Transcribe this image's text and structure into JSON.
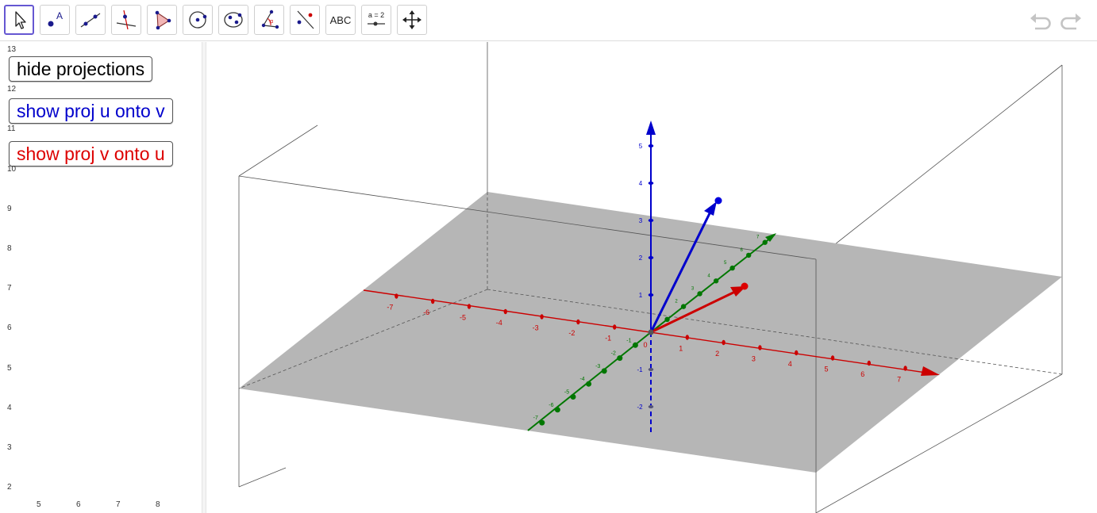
{
  "toolbar": {
    "tools": [
      {
        "name": "move-tool-icon",
        "selected": true
      },
      {
        "name": "point-tool-icon"
      },
      {
        "name": "line-tool-icon"
      },
      {
        "name": "perpendicular-line-tool-icon"
      },
      {
        "name": "polygon-tool-icon"
      },
      {
        "name": "circle-tool-icon"
      },
      {
        "name": "ellipse-tool-icon"
      },
      {
        "name": "angle-tool-icon"
      },
      {
        "name": "reflect-tool-icon"
      },
      {
        "name": "text-tool-icon",
        "label": "ABC"
      },
      {
        "name": "slider-tool-icon",
        "label": "a = 2"
      },
      {
        "name": "move-graphics-view-tool-icon"
      }
    ],
    "undo_icon": "undo-icon",
    "redo_icon": "redo-icon"
  },
  "left_panel": {
    "buttons": [
      {
        "label": "hide projections",
        "color": "#000000"
      },
      {
        "label": "show proj u onto v",
        "color": "#0000cc"
      },
      {
        "label": "show proj v onto u",
        "color": "#dd0000"
      }
    ],
    "y_axis_labels": [
      "13",
      "12",
      "11",
      "10",
      "9",
      "8",
      "7",
      "6",
      "5",
      "4",
      "3",
      "2"
    ],
    "x_axis_labels": [
      "5",
      "6",
      "7",
      "8"
    ]
  },
  "view3d": {
    "colors": {
      "x_axis": "#cc0000",
      "y_axis": "#007700",
      "z_axis": "#0000cc",
      "plane": "#b6b6b6",
      "vector_u": "#0000cc",
      "vector_v": "#cc0000"
    },
    "x_axis_labels": {
      "negative": [
        "-7",
        "-6",
        "-5",
        "-4",
        "-3",
        "-2",
        "-1"
      ],
      "positive": [
        "1",
        "2",
        "3",
        "4",
        "5",
        "6",
        "7"
      ]
    },
    "y_axis_labels": {
      "negative": [
        "-7",
        "-6",
        "-5",
        "-4",
        "-3",
        "-2",
        "-1"
      ],
      "positive": [
        "1",
        "2",
        "3",
        "4",
        "5",
        "6",
        "7"
      ]
    },
    "z_axis_labels": {
      "negative": [
        "-1",
        "-2"
      ],
      "positive": [
        "1",
        "2",
        "3",
        "4",
        "5"
      ]
    },
    "origin_label": "0"
  }
}
